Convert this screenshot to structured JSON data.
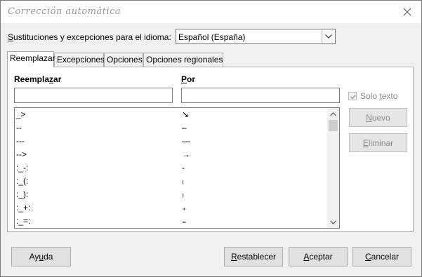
{
  "window": {
    "title": "Corrección automática"
  },
  "language": {
    "label": "Sustituciones y excepciones para el idioma:",
    "selected": "Español (España)"
  },
  "tabs": [
    {
      "label": "Reemplazar"
    },
    {
      "label": "Excepciones"
    },
    {
      "label": "Opciones"
    },
    {
      "label": "Opciones regionales"
    }
  ],
  "replace": {
    "replace_label": "Reemplazar",
    "with_label": "Por",
    "replace_value": "",
    "with_value": "",
    "text_only_label": "Solo texto",
    "text_only_checked": true,
    "new_label": "Nuevo",
    "delete_label": "Eliminar"
  },
  "table": {
    "rows": [
      {
        "replace": "_>",
        "with": "↘"
      },
      {
        "replace": "--",
        "with": "–"
      },
      {
        "replace": "---",
        "with": "—"
      },
      {
        "replace": "-->",
        "with": "→"
      },
      {
        "replace": ":_-:",
        "with": "-"
      },
      {
        "replace": ":_(:",
        "with": "₍"
      },
      {
        "replace": ":_):",
        "with": "₎"
      },
      {
        "replace": ":_+:",
        "with": "₊"
      },
      {
        "replace": ":_=:",
        "with": "₌"
      }
    ]
  },
  "footer": {
    "help_label": "Ayuda",
    "reset_label": "Restablecer",
    "ok_label": "Aceptar",
    "cancel_label": "Cancelar"
  }
}
